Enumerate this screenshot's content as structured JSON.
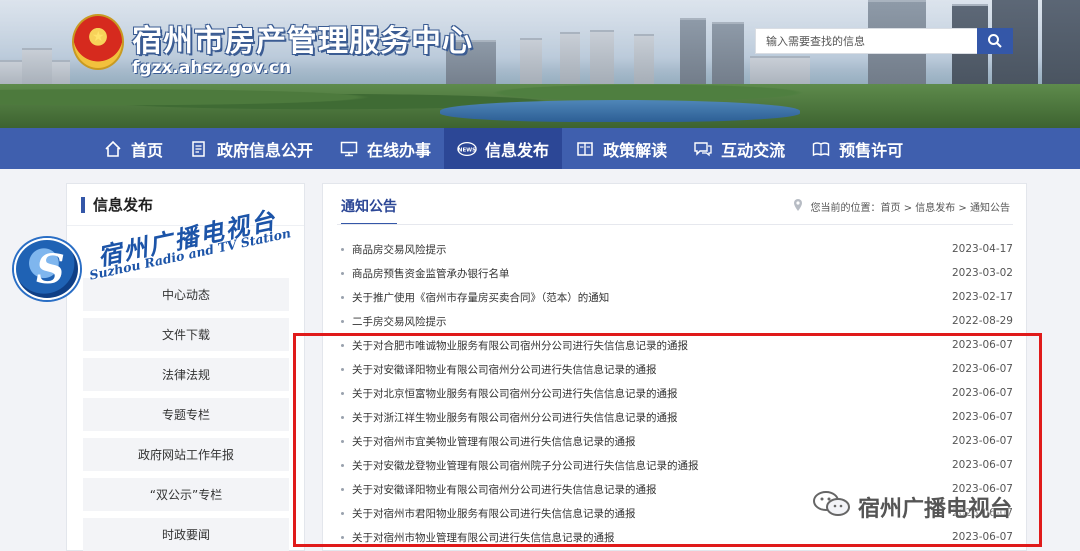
{
  "header": {
    "site_title": "宿州市房产管理服务中心",
    "site_domain": "fgzx.ahsz.gov.cn",
    "search_placeholder": "输入需要查找的信息"
  },
  "nav": [
    {
      "label": "首页",
      "icon": "home-icon"
    },
    {
      "label": "政府信息公开",
      "icon": "document-icon"
    },
    {
      "label": "在线办事",
      "icon": "monitor-icon"
    },
    {
      "label": "信息发布",
      "icon": "news-icon",
      "active": true
    },
    {
      "label": "政策解读",
      "icon": "book-icon"
    },
    {
      "label": "互动交流",
      "icon": "chat-icon"
    },
    {
      "label": "预售许可",
      "icon": "open-book-icon"
    }
  ],
  "sidebar": {
    "title": "信息发布",
    "items": [
      "中心动态",
      "文件下载",
      "法律法规",
      "专题专栏",
      "政府网站工作年报",
      "“双公示”专栏",
      "时政要闻"
    ]
  },
  "content": {
    "tab_title": "通知公告",
    "breadcrumb": {
      "prefix": "您当前的位置：",
      "path": "首页 > 信息发布 > 通知公告"
    },
    "news": [
      {
        "title": "商品房交易风险提示",
        "date": "2023-04-17"
      },
      {
        "title": "商品房预售资金监管承办银行名单",
        "date": "2023-03-02"
      },
      {
        "title": "关于推广使用《宿州市存量房买卖合同》（范本）的通知",
        "date": "2023-02-17"
      },
      {
        "title": "二手房交易风险提示",
        "date": "2022-08-29"
      },
      {
        "title": "关于对合肥市唯诚物业服务有限公司宿州分公司进行失信信息记录的通报",
        "date": "2023-06-07"
      },
      {
        "title": "关于对安徽译阳物业有限公司宿州分公司进行失信信息记录的通报",
        "date": "2023-06-07"
      },
      {
        "title": "关于对北京恒富物业服务有限公司宿州分公司进行失信信息记录的通报",
        "date": "2023-06-07"
      },
      {
        "title": "关于对浙江祥生物业服务有限公司宿州分公司进行失信信息记录的通报",
        "date": "2023-06-07"
      },
      {
        "title": "关于对宿州市宜美物业管理有限公司进行失信信息记录的通报",
        "date": "2023-06-07"
      },
      {
        "title": "关于对安徽龙登物业管理有限公司宿州院子分公司进行失信信息记录的通报",
        "date": "2023-06-07"
      },
      {
        "title": "关于对安徽译阳物业有限公司宿州分公司进行失信信息记录的通报",
        "date": "2023-06-07"
      },
      {
        "title": "关于对宿州市君阳物业服务有限公司进行失信信息记录的通报",
        "date": "2023-06-07"
      },
      {
        "title": "关于对宿州市物业管理有限公司进行失信信息记录的通报",
        "date": "2023-06-07"
      }
    ]
  },
  "watermarks": {
    "tv_cn": "宿州广播电视台",
    "tv_en": "Suzhou Radio and TV Station",
    "wechat_label": "宿州广播电视台"
  },
  "colors": {
    "nav_bg": "#3f5fae",
    "nav_active": "#2c4796",
    "accent": "#3457a8",
    "highlight_box": "#e01a1a"
  }
}
